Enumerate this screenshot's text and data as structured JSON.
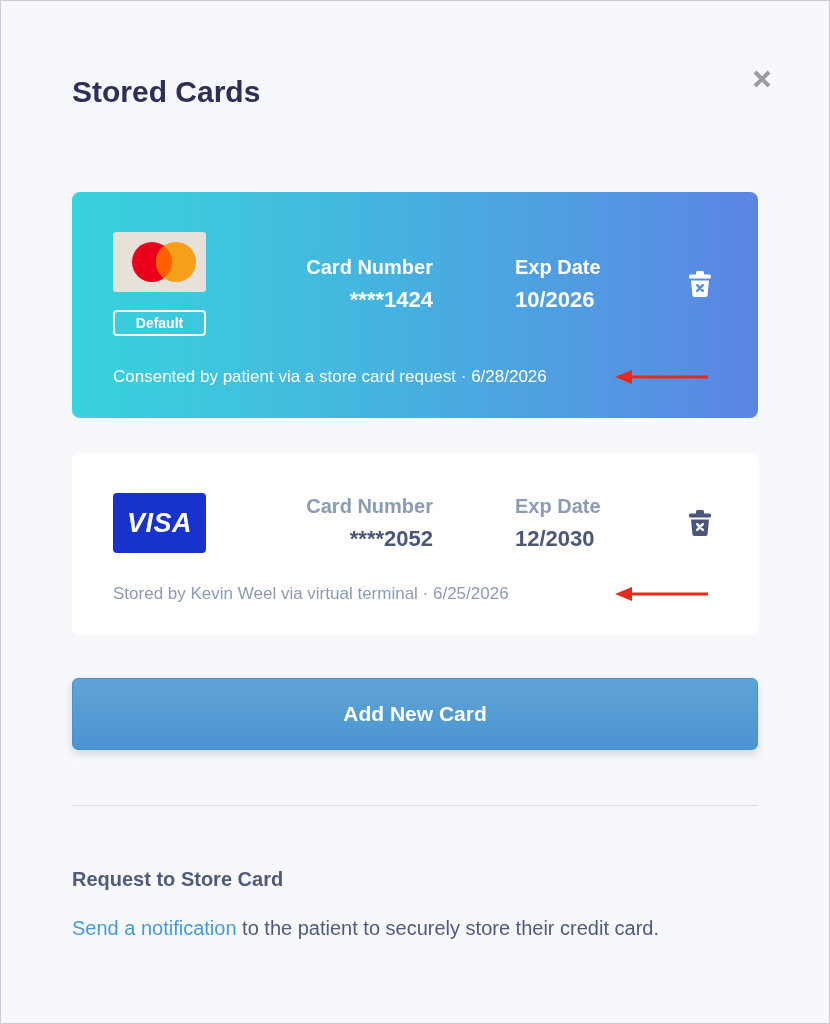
{
  "dialog": {
    "title": "Stored Cards"
  },
  "cards": [
    {
      "logo": {
        "kind": "circles"
      },
      "default": true,
      "badge": "Default",
      "number_label": "Card Number",
      "number": "****1424",
      "exp_label": "Exp Date",
      "exp": "10/2026",
      "note": "Consented by patient via a store card request · 6/28/2026",
      "arrow": true
    },
    {
      "logo": {
        "kind": "wordmark",
        "text": "VISA"
      },
      "default": false,
      "number_label": "Card Number",
      "number": "****2052",
      "exp_label": "Exp Date",
      "exp": "12/2030",
      "note": "Stored by Kevin Weel via virtual terminal · 6/25/2026",
      "arrow": true
    }
  ],
  "add_button": "Add New Card",
  "request": {
    "title": "Request to Store Card",
    "link": "Send a notification",
    "text": "to the patient to securely store their credit card."
  }
}
